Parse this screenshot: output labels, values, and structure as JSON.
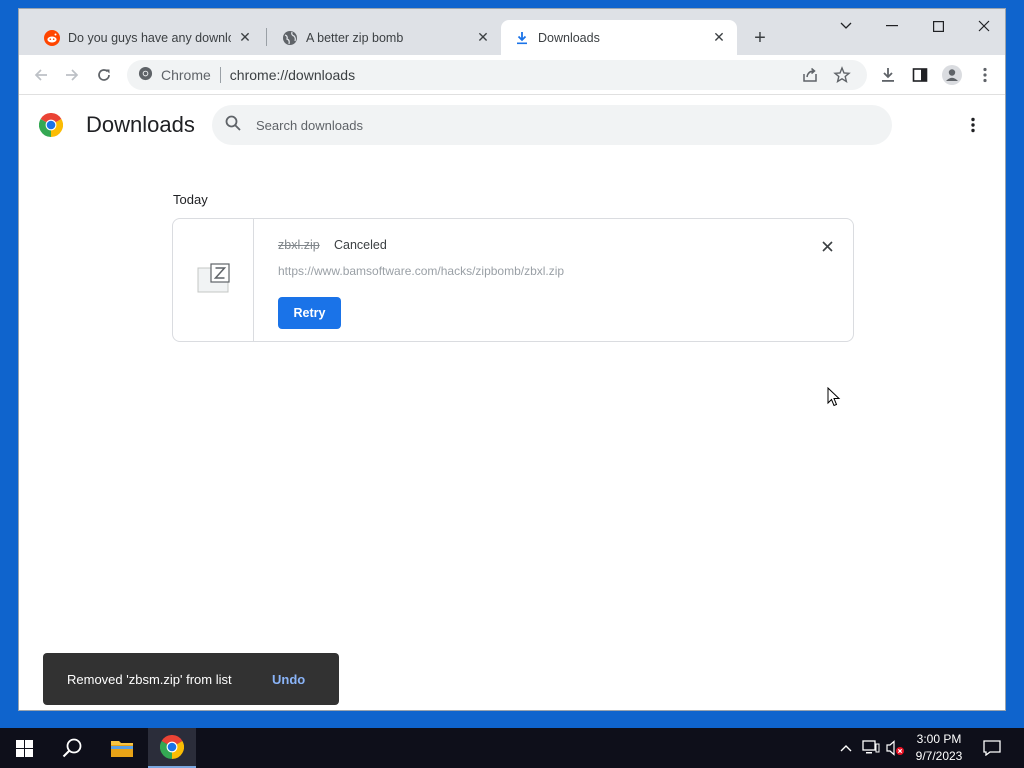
{
  "browser": {
    "tabs": [
      {
        "title": "Do you guys have any download",
        "favicon": "reddit-icon",
        "active": false
      },
      {
        "title": "A better zip bomb",
        "favicon": "globe-icon",
        "active": false
      },
      {
        "title": "Downloads",
        "favicon": "download-icon",
        "active": true
      }
    ],
    "omnibox": {
      "site_label": "Chrome",
      "url": "chrome://downloads"
    }
  },
  "page": {
    "title": "Downloads",
    "search": {
      "placeholder": "Search downloads",
      "value": ""
    },
    "section_label": "Today",
    "items": [
      {
        "filename": "zbxl.zip",
        "status": "Canceled",
        "url": "https://www.bamsoftware.com/hacks/zipbomb/zbxl.zip",
        "action_label": "Retry"
      }
    ]
  },
  "toast": {
    "message": "Removed 'zbsm.zip' from list",
    "action": "Undo"
  },
  "taskbar": {
    "time": "3:00 PM",
    "date": "9/7/2023"
  },
  "colors": {
    "accent": "#1a73e8",
    "titlebar": "#dee1e6",
    "toast_bg": "#323232",
    "link": "#8ab4f8"
  }
}
